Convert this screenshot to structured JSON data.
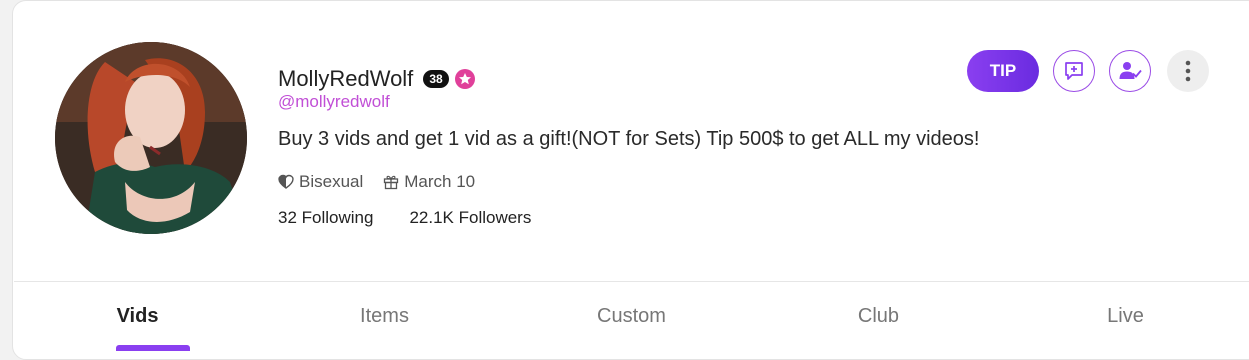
{
  "profile": {
    "name": "MollyRedWolf",
    "level": "38",
    "handle": "@mollyredwolf",
    "bio": "Buy 3 vids and get 1 vid as a gift!(NOT for Sets) Tip 500$ to get ALL my videos!",
    "orientation": "Bisexual",
    "birthday": "March 10",
    "following": "32 Following",
    "followers": "22.1K Followers"
  },
  "actions": {
    "tip_label": "TIP",
    "message_icon": "message-plus-icon",
    "subscribe_icon": "user-check-icon",
    "more_icon": "more-vertical-icon"
  },
  "tabs": [
    {
      "label": "Vids",
      "active": true
    },
    {
      "label": "Items",
      "active": false
    },
    {
      "label": "Custom",
      "active": false
    },
    {
      "label": "Club",
      "active": false
    },
    {
      "label": "Live",
      "active": false
    }
  ],
  "colors": {
    "accent": "#8a3ff0",
    "handle": "#c14fd6",
    "verified": "#e0409a"
  }
}
